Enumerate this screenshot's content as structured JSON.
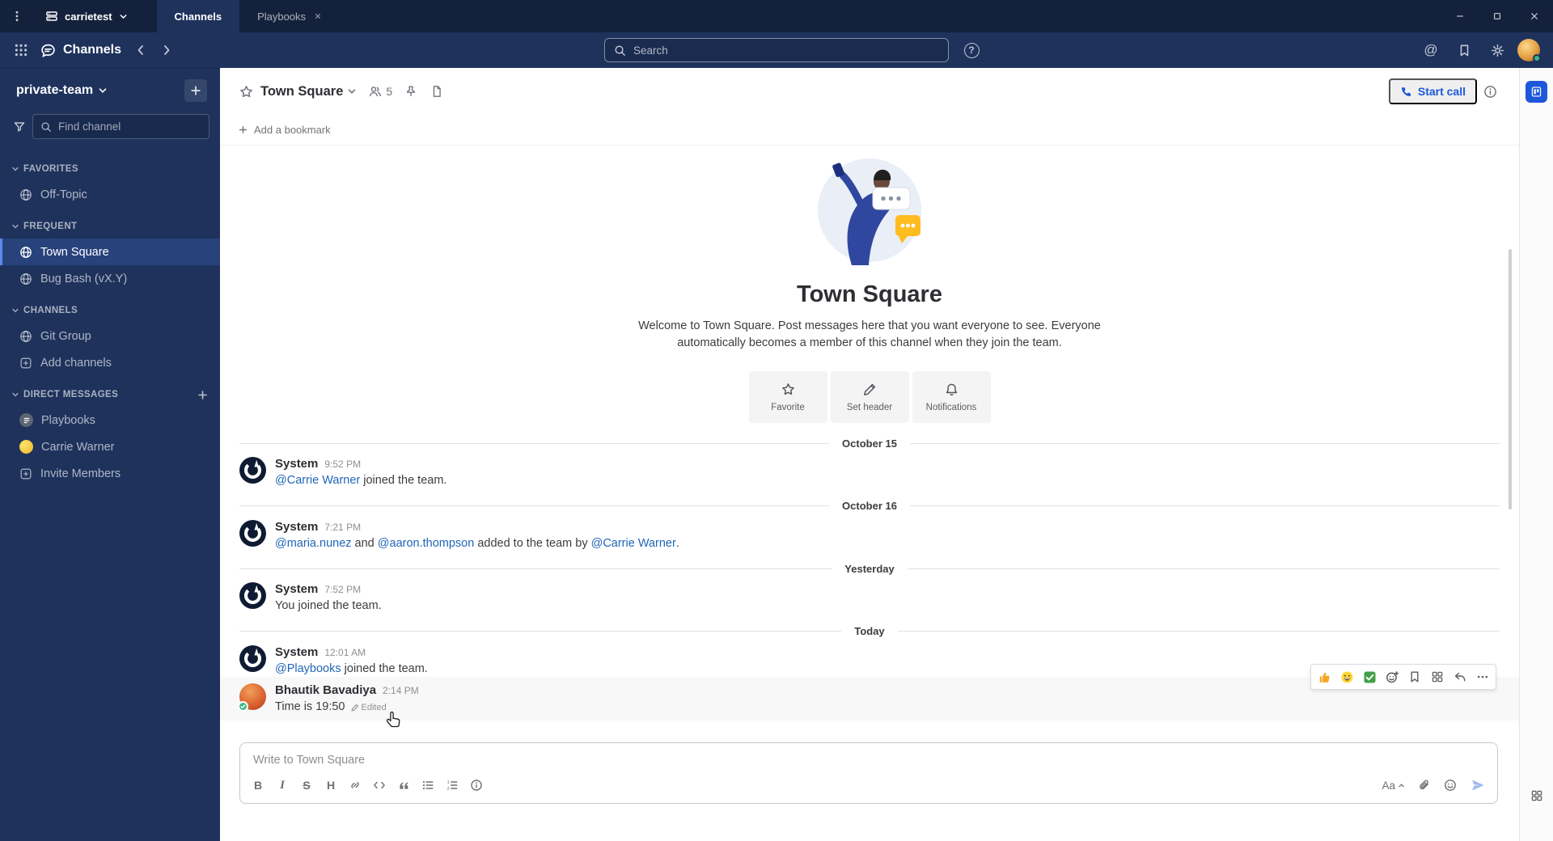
{
  "colors": {
    "accent": "#1c58d9",
    "link": "#2066b8",
    "sidebar_bg": "#1e325c",
    "titlebar_bg": "#14213c"
  },
  "titlebar": {
    "server_name": "carrietest",
    "tab_channels": "Channels",
    "tab_playbooks": "Playbooks"
  },
  "global_header": {
    "product": "Channels",
    "search_placeholder": "Search"
  },
  "sidebar": {
    "team_name": "private-team",
    "find_placeholder": "Find channel",
    "sections": {
      "favorites": {
        "label": "FAVORITES",
        "items": [
          {
            "label": "Off-Topic"
          }
        ]
      },
      "frequent": {
        "label": "FREQUENT",
        "items": [
          {
            "label": "Town Square"
          },
          {
            "label": "Bug Bash (vX.Y)"
          }
        ]
      },
      "channels": {
        "label": "CHANNELS",
        "items": [
          {
            "label": "Git Group"
          },
          {
            "label": "Add channels"
          }
        ]
      },
      "dms": {
        "label": "DIRECT MESSAGES",
        "items": [
          {
            "label": "Playbooks"
          },
          {
            "label": "Carrie Warner"
          },
          {
            "label": "Invite Members"
          }
        ]
      }
    }
  },
  "channel": {
    "name": "Town Square",
    "member_count": "5",
    "start_call_label": "Start call",
    "add_bookmark_label": "Add a bookmark"
  },
  "intro": {
    "title": "Town Square",
    "description": "Welcome to Town Square. Post messages here that you want everyone to see. Everyone automatically becomes a member of this channel when they join the team.",
    "actions": [
      {
        "label": "Favorite"
      },
      {
        "label": "Set header"
      },
      {
        "label": "Notifications"
      }
    ]
  },
  "timeline": {
    "dividers": {
      "d1": "October 15",
      "d2": "October 16",
      "d3": "Yesterday",
      "d4": "Today"
    },
    "posts": {
      "p1": {
        "author": "System",
        "time": "9:52 PM",
        "link1": "@Carrie Warner",
        "text1": " joined the team."
      },
      "p2": {
        "author": "System",
        "time": "7:21 PM",
        "link1": "@maria.nunez",
        "text1": " and ",
        "link2": "@aaron.thompson",
        "text2": " added to the team by ",
        "link3": "@Carrie Warner",
        "text3": "."
      },
      "p3": {
        "author": "System",
        "time": "7:52 PM",
        "text1": "You joined the team."
      },
      "p4": {
        "author": "System",
        "time": "12:01 AM",
        "link1": "@Playbooks",
        "text1": " joined the team."
      },
      "p5": {
        "author": "Bhautik Bavadiya",
        "time": "2:14 PM",
        "text1": "Time is 19:50",
        "edited_label": "Edited"
      }
    }
  },
  "hover_menu": {
    "quick_reactions": [
      "thumbs-up",
      "grinning-face",
      "check-mark"
    ]
  },
  "composer": {
    "placeholder": "Write to Town Square",
    "format_toggle_label": "Aa"
  }
}
